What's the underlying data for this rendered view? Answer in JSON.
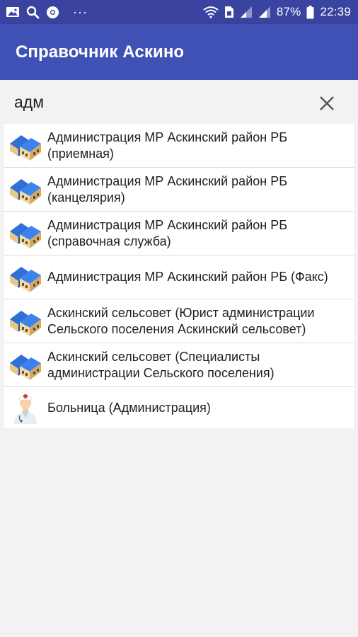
{
  "status": {
    "battery": "87%",
    "time": "22:39",
    "more_dots": "···"
  },
  "appbar": {
    "title": "Справочник Аскино"
  },
  "search": {
    "value": "адм"
  },
  "results": [
    {
      "text": "Администрация МР  Аскинский район РБ (приемная)",
      "icon": "building-icon"
    },
    {
      "text": "Администрация МР  Аскинский район РБ (канцелярия)",
      "icon": "building-icon"
    },
    {
      "text": "Администрация МР  Аскинский район РБ (справочная служба)",
      "icon": "building-icon"
    },
    {
      "text": "Администрация МР  Аскинский район РБ (Факс)",
      "icon": "building-icon"
    },
    {
      "text": "Аскинский сельсовет (Юрист администрации Сельского поселения Аскинский сельсовет)",
      "icon": "building-icon"
    },
    {
      "text": "Аскинский сельсовет (Специалисты администрации Сельского поселения)",
      "icon": "building-icon"
    },
    {
      "text": "Больница (Администрация)",
      "icon": "doctor-icon"
    }
  ],
  "colors": {
    "statusbar": "#3a43a0",
    "appbar": "#3f51b5",
    "background": "#f2f2f2"
  }
}
